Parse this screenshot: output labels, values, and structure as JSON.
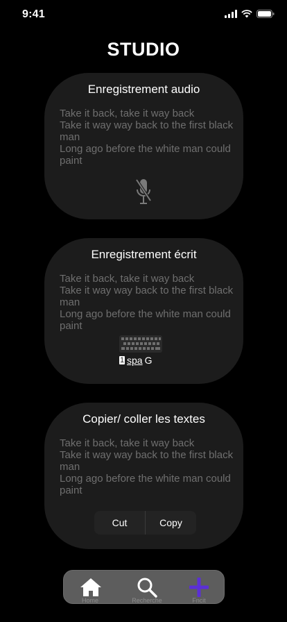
{
  "status_bar": {
    "time": "9:41",
    "icons": [
      "signal-icon",
      "wifi-icon",
      "battery-icon"
    ]
  },
  "page": {
    "title": "STUDIO"
  },
  "cards": [
    {
      "title": "Enregistrement audio",
      "lines": [
        "Take it back, take it way back",
        "Take it way way back to the first black man",
        "Long ago before the white man could paint"
      ],
      "icon": "microphone-off-icon"
    },
    {
      "title": "Enregistrement écrit",
      "lines": [
        "Take it back, take it way back",
        "Take it way way back to the first black man",
        "Long ago before the white man could paint"
      ],
      "icon": "keyboard-icon",
      "keyboard_row": {
        "left_key": "1",
        "space_label": "spa",
        "right_key": "G"
      }
    },
    {
      "title": "Copier/ coller les textes",
      "lines": [
        "Take it back, take it way back",
        "Take it way way back to the first black man",
        "Long ago before the white man could paint"
      ],
      "edit_menu": {
        "cut_label": "Cut",
        "copy_label": "Copy"
      }
    }
  ],
  "tab_bar": {
    "tabs": [
      {
        "label": "Home",
        "icon": "home-icon"
      },
      {
        "label": "Recherche",
        "icon": "search-icon"
      },
      {
        "label": "Fncit",
        "icon": "plus-icon"
      }
    ]
  },
  "colors": {
    "background": "#000000",
    "card": "#1c1c1c",
    "muted_text": "#6f6f6f",
    "tab_bar": "#5d5d5d",
    "accent": "#5b2fd6"
  }
}
